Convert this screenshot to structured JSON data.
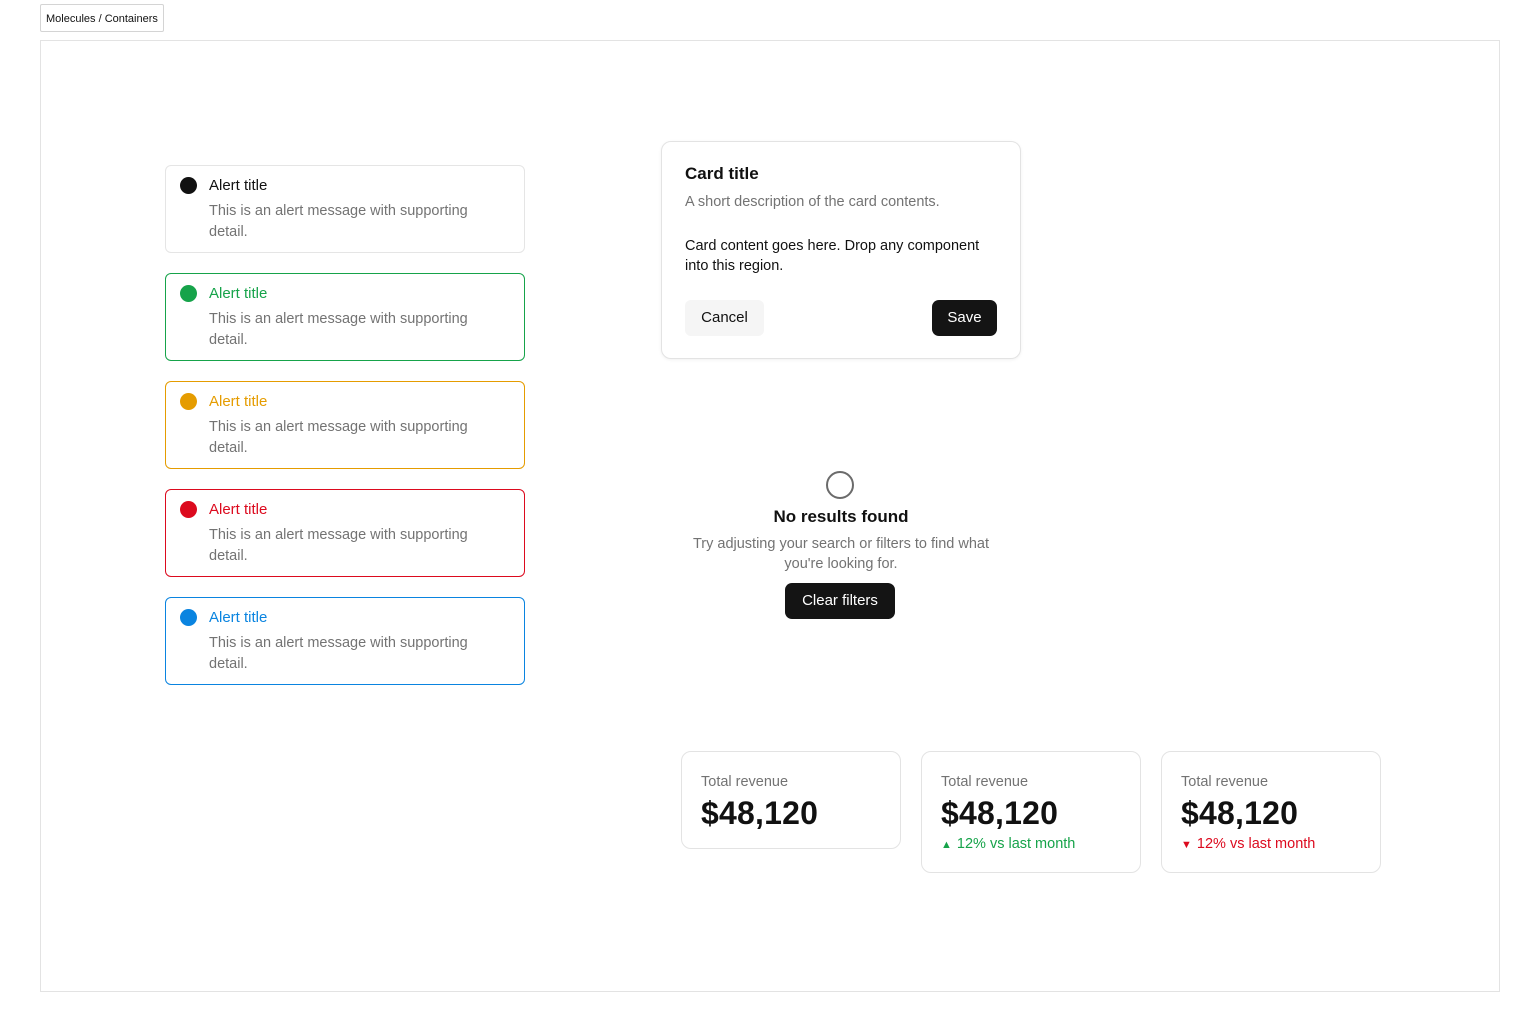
{
  "breadcrumb": "Molecules / Containers",
  "alerts": [
    {
      "title": "Alert title",
      "message": "This is an alert message with supporting detail.",
      "variant": "neutral",
      "color": "#111111",
      "border": "#e5e5e5"
    },
    {
      "title": "Alert title",
      "message": "This is an alert message with supporting detail.",
      "variant": "success",
      "color": "#16a34a",
      "border": "#16a34a"
    },
    {
      "title": "Alert title",
      "message": "This is an alert message with supporting detail.",
      "variant": "warning",
      "color": "#e59c00",
      "border": "#e59c00"
    },
    {
      "title": "Alert title",
      "message": "This is an alert message with supporting detail.",
      "variant": "danger",
      "color": "#dc0a1e",
      "border": "#dc0a1e"
    },
    {
      "title": "Alert title",
      "message": "This is an alert message with supporting detail.",
      "variant": "info",
      "color": "#0a84e0",
      "border": "#0a84e0"
    }
  ],
  "card": {
    "title": "Card title",
    "description": "A short description of the card contents.",
    "body": "Card content goes here. Drop any component into this region.",
    "cancel_label": "Cancel",
    "save_label": "Save"
  },
  "empty_state": {
    "icon": "circle-icon",
    "title": "No results found",
    "description": "Try adjusting your search or filters to find what you're looking for.",
    "action_label": "Clear filters"
  },
  "stats": [
    {
      "label": "Total revenue",
      "value": "$48,120",
      "delta": "",
      "direction": "none"
    },
    {
      "label": "Total revenue",
      "value": "$48,120",
      "delta": "12% vs last month",
      "direction": "up",
      "color": "#16a34a",
      "icon": "triangle-up-icon"
    },
    {
      "label": "Total revenue",
      "value": "$48,120",
      "delta": "12% vs last month",
      "direction": "down",
      "color": "#dc0a1e",
      "icon": "triangle-down-icon"
    }
  ]
}
